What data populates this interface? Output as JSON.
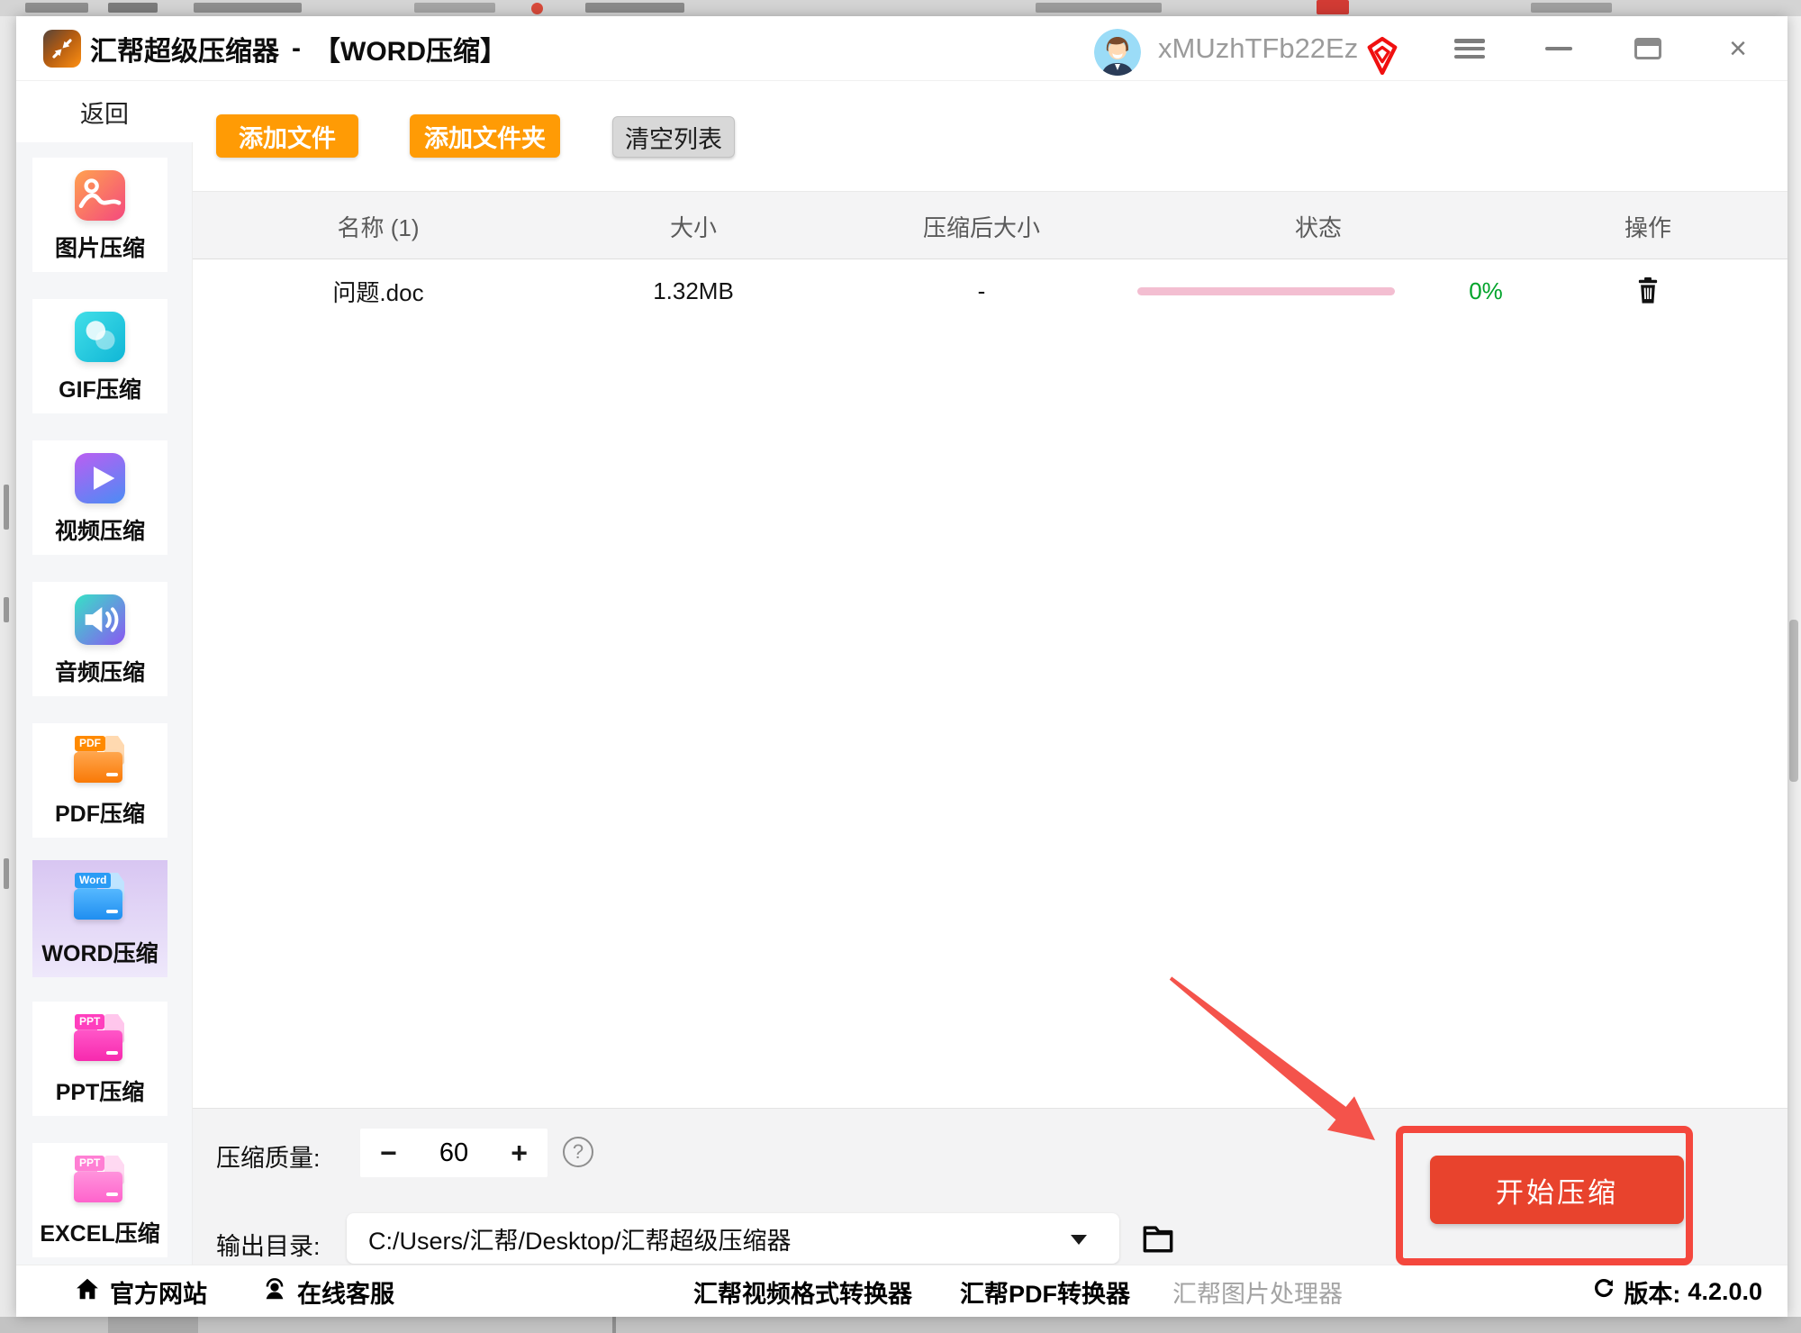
{
  "titlebar": {
    "app_name": "汇帮超级压缩器",
    "separator": "-",
    "mode": "【WORD压缩】",
    "username": "xMUzhTFb22Ez"
  },
  "sidebar": {
    "back": "返回",
    "items": [
      {
        "label": "图片压缩"
      },
      {
        "label": "GIF压缩"
      },
      {
        "label": "视频压缩"
      },
      {
        "label": "音频压缩"
      },
      {
        "label": "PDF压缩",
        "badge": "PDF"
      },
      {
        "label": "WORD压缩",
        "badge": "Word",
        "selected": true
      },
      {
        "label": "PPT压缩",
        "badge": "PPT"
      },
      {
        "label": "EXCEL压缩",
        "badge": "PPT"
      }
    ]
  },
  "toolbar": {
    "add_file": "添加文件",
    "add_folder": "添加文件夹",
    "clear_list": "清空列表"
  },
  "table": {
    "headers": [
      "名称 (1)",
      "大小",
      "压缩后大小",
      "状态",
      "操作"
    ],
    "rows": [
      {
        "name": "问题.doc",
        "size": "1.32MB",
        "compressed_size": "-",
        "percent": "0%"
      }
    ]
  },
  "panel": {
    "quality_label": "压缩质量:",
    "minus": "−",
    "quality_value": "60",
    "plus": "+",
    "help": "?",
    "output_label": "输出目录:",
    "output_path": "C:/Users/汇帮/Desktop/汇帮超级压缩器",
    "start_button": "开始压缩"
  },
  "footer": {
    "links": [
      {
        "label": "官方网站"
      },
      {
        "label": "在线客服"
      },
      {
        "label": "汇帮视频格式转换器"
      },
      {
        "label": "汇帮PDF转换器"
      },
      {
        "label": "汇帮图片处理器"
      }
    ],
    "version_label": "版本:",
    "version": "4.2.0.0"
  },
  "colors": {
    "accent_orange": "#ff9b05",
    "start_red": "#e8432d",
    "annotation_red": "#f4473d",
    "progress_pink": "#f3bed1",
    "percent_green": "#00a32a",
    "selected_purple": "#e3d7f6"
  }
}
